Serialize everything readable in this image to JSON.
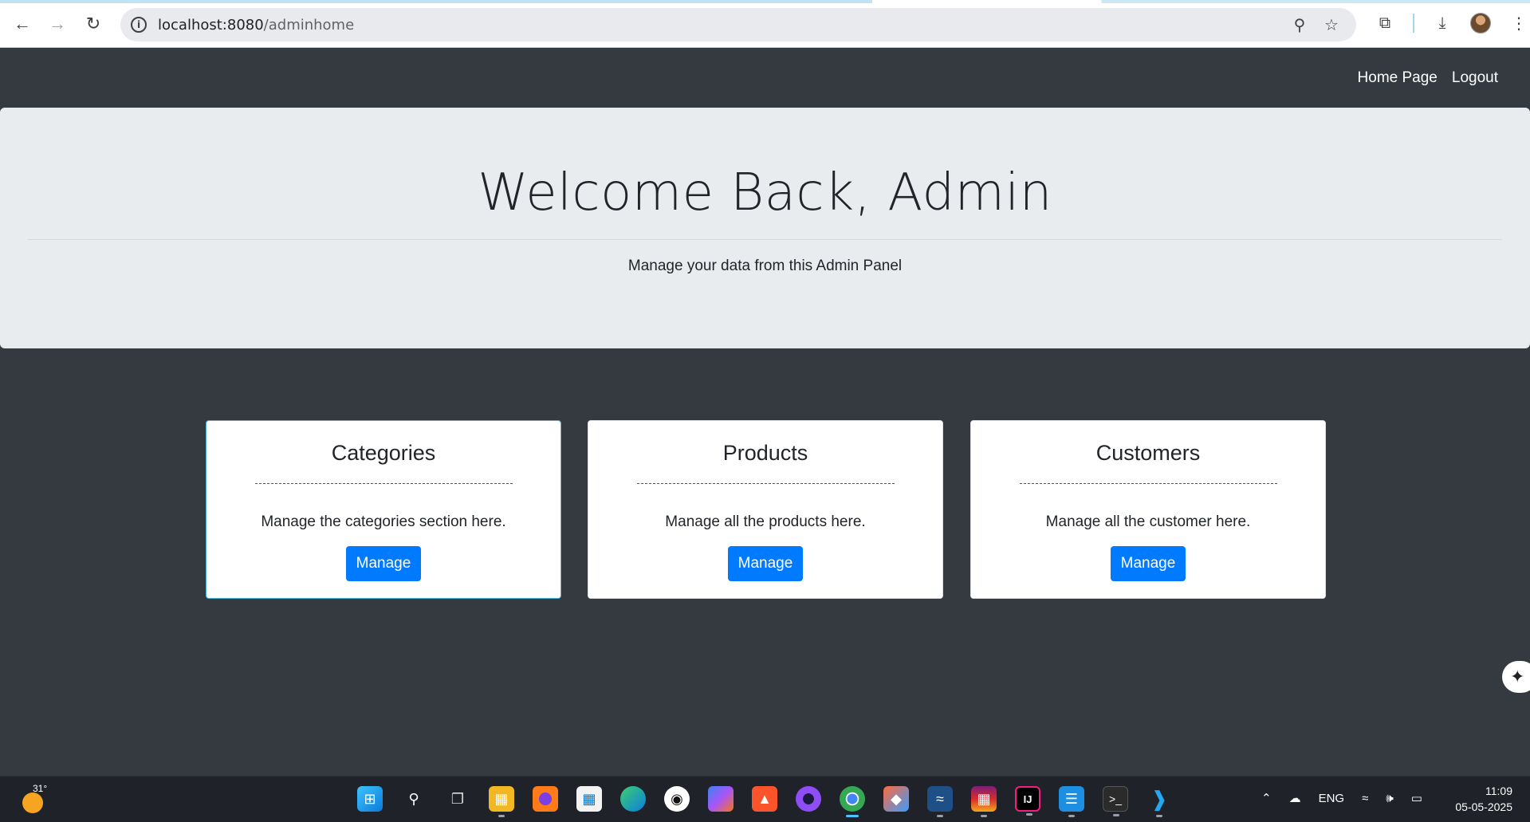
{
  "browser": {
    "url_host": "localhost:8080",
    "url_path": "/adminhome"
  },
  "navbar": {
    "links": [
      "Home Page",
      "Logout"
    ]
  },
  "jumbotron": {
    "title": "Welcome Back, Admin",
    "subtitle": "Manage your data from this Admin Panel"
  },
  "cards": [
    {
      "title": "Categories",
      "divider": "--------------------------------------------",
      "description": "Manage the categories section here.",
      "button": "Manage"
    },
    {
      "title": "Products",
      "divider": "--------------------------------------------",
      "description": "Manage all the products here.",
      "button": "Manage"
    },
    {
      "title": "Customers",
      "divider": "--------------------------------------------",
      "description": "Manage all the customer here.",
      "button": "Manage"
    }
  ],
  "taskbar": {
    "weather_temp": "31°",
    "language": "ENG",
    "time": "11:09",
    "date": "05-05-2025"
  },
  "colors": {
    "primary_button": "#007bff",
    "page_background": "#343a40",
    "jumbotron_background": "#e9ecef"
  }
}
